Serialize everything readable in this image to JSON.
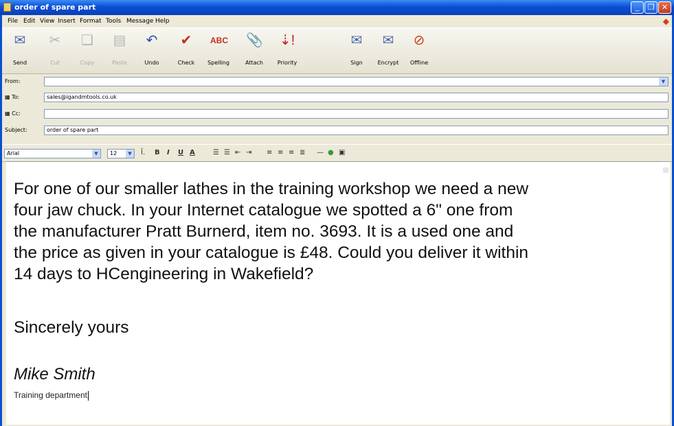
{
  "window": {
    "title": "order of spare part"
  },
  "menu": [
    "File",
    "Edit",
    "View",
    "Insert",
    "Format",
    "Tools",
    "Message",
    "Help"
  ],
  "toolbar": [
    {
      "label": "Send",
      "icon": "send-icon",
      "enabled": true
    },
    {
      "label": "Cut",
      "icon": "cut-icon",
      "enabled": false
    },
    {
      "label": "Copy",
      "icon": "copy-icon",
      "enabled": false
    },
    {
      "label": "Paste",
      "icon": "paste-icon",
      "enabled": false
    },
    {
      "label": "Undo",
      "icon": "undo-icon",
      "enabled": true
    },
    {
      "label": "Check",
      "icon": "check-names-icon",
      "enabled": true
    },
    {
      "label": "Spelling",
      "icon": "spelling-icon",
      "enabled": true
    },
    {
      "label": "Attach",
      "icon": "paperclip-icon",
      "enabled": true
    },
    {
      "label": "Priority",
      "icon": "priority-icon",
      "enabled": true
    },
    {
      "label": "Sign",
      "icon": "sign-icon",
      "enabled": true
    },
    {
      "label": "Encrypt",
      "icon": "encrypt-icon",
      "enabled": true
    },
    {
      "label": "Offline",
      "icon": "offline-icon",
      "enabled": true
    }
  ],
  "header": {
    "from_label": "From:",
    "from_value": "",
    "to_label": "To:",
    "to_value": "sales@igandmtools.co.uk",
    "cc_label": "Cc:",
    "cc_value": "",
    "subject_label": "Subject:",
    "subject_value": "order of spare part"
  },
  "format": {
    "font": "Arial",
    "size": "12"
  },
  "message": {
    "lines": [
      "For one of our smaller lathes in the training workshop we need a new",
      "four jaw chuck. In your Internet catalogue we spotted  a 6\" one from",
      "the manufacturer Pratt Burnerd, item no. 3693. It is a used one and",
      "the price as given in your catalogue is  £48. Could you deliver it within",
      "14 days to HCengineering in Wakefield?"
    ],
    "closing": "Sincerely yours",
    "signature_name": "Mike Smith",
    "signature_dept": "Training department"
  },
  "colors": {
    "titlebar": "#0a4fd6",
    "chrome": "#ece9d8",
    "field_border": "#7f9db9"
  }
}
